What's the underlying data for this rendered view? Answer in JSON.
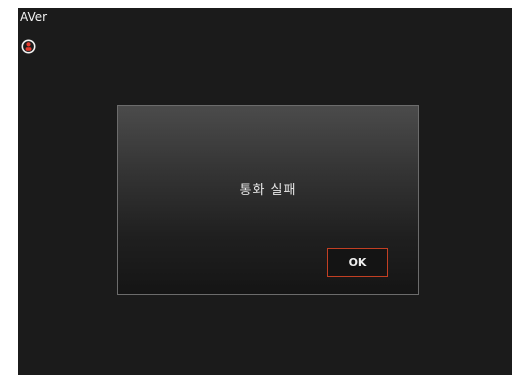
{
  "app": {
    "brand": "AVer",
    "status_icon": "person-icon",
    "accent_color": "#e23a2d"
  },
  "dialog": {
    "message": "통화 실패",
    "ok_label": "OK",
    "button_border_color": "#c23f23"
  }
}
